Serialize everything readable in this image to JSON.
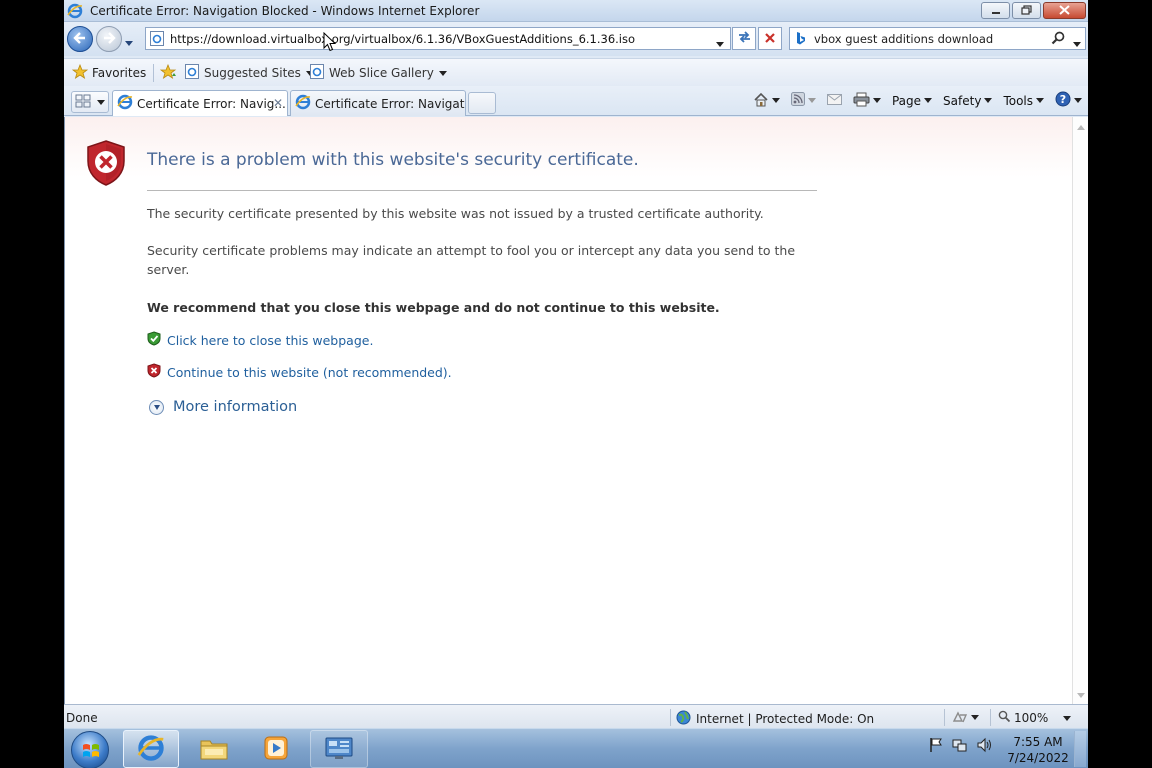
{
  "window": {
    "title": "Certificate Error: Navigation Blocked - Windows Internet Explorer",
    "controls": [
      "minimize-icon",
      "restore-icon",
      "close-icon"
    ]
  },
  "navigation": {
    "address": "https://download.virtualbox.org/virtualbox/6.1.36/VBoxGuestAdditions_6.1.36.iso",
    "search_query": "vbox guest additions  download"
  },
  "favorites_bar": {
    "favorites_label": "Favorites",
    "suggested_sites_label": "Suggested Sites",
    "web_slice_label": "Web Slice Gallery"
  },
  "tabs": [
    {
      "label": "Certificate Error: Navig...",
      "active": true
    },
    {
      "label": "Certificate Error: Navigatio...",
      "active": false
    }
  ],
  "command_bar": {
    "page_label": "Page",
    "safety_label": "Safety",
    "tools_label": "Tools"
  },
  "error_page": {
    "title": "There is a problem with this website's security certificate.",
    "paragraph1": "The security certificate presented by this website was not issued by a trusted certificate authority.",
    "paragraph2": "Security certificate problems may indicate an attempt to fool you or intercept any data you send to the server.",
    "recommendation": "We recommend that you close this webpage and do not continue to this website.",
    "close_link": "Click here to close this webpage.",
    "continue_link": "Continue to this website (not recommended).",
    "more_info": "More information"
  },
  "status_bar": {
    "status": "Done",
    "zone": "Internet | Protected Mode: On",
    "zoom": "100%"
  },
  "taskbar": {
    "time": "7:55 AM",
    "date": "7/24/2022"
  },
  "colors": {
    "title_blue": "#4a6896",
    "link_blue": "#1f5f9e",
    "shield_red": "#c0262d",
    "shield_green": "#3a9b35"
  }
}
